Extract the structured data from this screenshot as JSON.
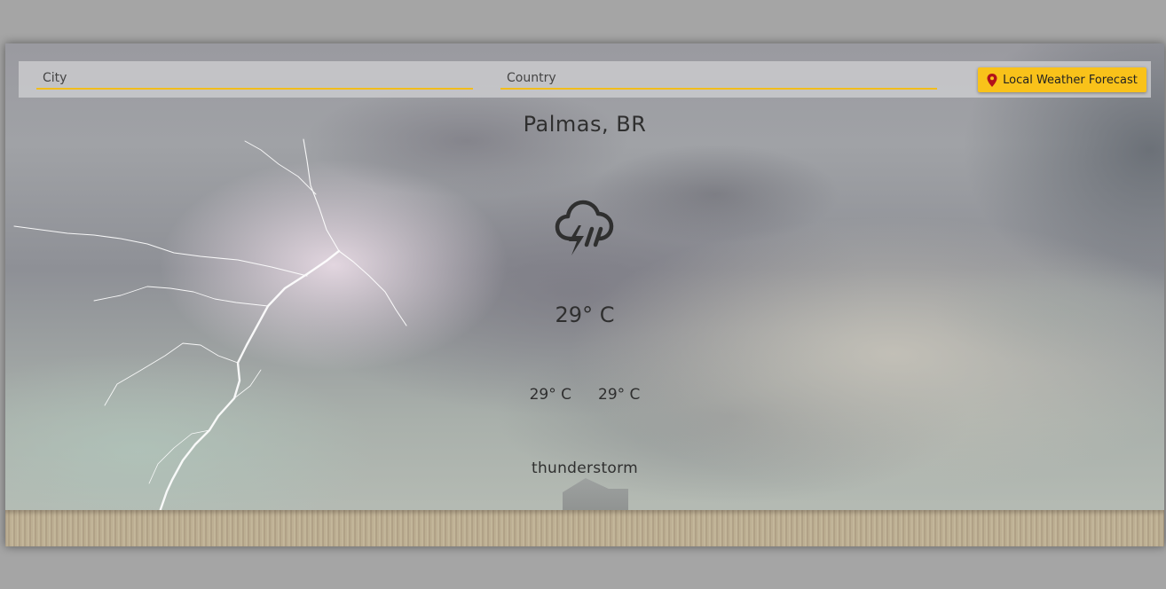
{
  "search": {
    "city_placeholder": "City",
    "country_placeholder": "Country",
    "local_button_label": "Local Weather Forecast",
    "local_button_icon": "map-pin-icon"
  },
  "weather": {
    "location": "Palmas, BR",
    "icon": "thunderstorm-icon",
    "temperature": "29° C",
    "temp_min": "29° C",
    "temp_max": "29° C",
    "description": "thunderstorm"
  },
  "colors": {
    "accent": "#f9c21a",
    "pin": "#b3121b",
    "text": "#2f2f2f"
  }
}
